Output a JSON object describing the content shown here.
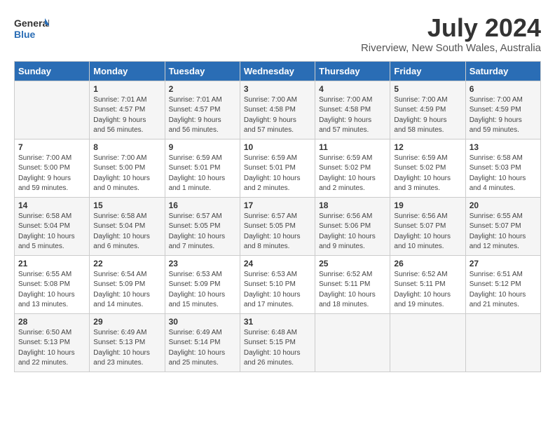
{
  "header": {
    "logo_line1": "General",
    "logo_line2": "Blue",
    "month_year": "July 2024",
    "location": "Riverview, New South Wales, Australia"
  },
  "weekdays": [
    "Sunday",
    "Monday",
    "Tuesday",
    "Wednesday",
    "Thursday",
    "Friday",
    "Saturday"
  ],
  "weeks": [
    [
      {
        "day": "",
        "info": ""
      },
      {
        "day": "1",
        "info": "Sunrise: 7:01 AM\nSunset: 4:57 PM\nDaylight: 9 hours\nand 56 minutes."
      },
      {
        "day": "2",
        "info": "Sunrise: 7:01 AM\nSunset: 4:57 PM\nDaylight: 9 hours\nand 56 minutes."
      },
      {
        "day": "3",
        "info": "Sunrise: 7:00 AM\nSunset: 4:58 PM\nDaylight: 9 hours\nand 57 minutes."
      },
      {
        "day": "4",
        "info": "Sunrise: 7:00 AM\nSunset: 4:58 PM\nDaylight: 9 hours\nand 57 minutes."
      },
      {
        "day": "5",
        "info": "Sunrise: 7:00 AM\nSunset: 4:59 PM\nDaylight: 9 hours\nand 58 minutes."
      },
      {
        "day": "6",
        "info": "Sunrise: 7:00 AM\nSunset: 4:59 PM\nDaylight: 9 hours\nand 59 minutes."
      }
    ],
    [
      {
        "day": "7",
        "info": "Sunrise: 7:00 AM\nSunset: 5:00 PM\nDaylight: 9 hours\nand 59 minutes."
      },
      {
        "day": "8",
        "info": "Sunrise: 7:00 AM\nSunset: 5:00 PM\nDaylight: 10 hours\nand 0 minutes."
      },
      {
        "day": "9",
        "info": "Sunrise: 6:59 AM\nSunset: 5:01 PM\nDaylight: 10 hours\nand 1 minute."
      },
      {
        "day": "10",
        "info": "Sunrise: 6:59 AM\nSunset: 5:01 PM\nDaylight: 10 hours\nand 2 minutes."
      },
      {
        "day": "11",
        "info": "Sunrise: 6:59 AM\nSunset: 5:02 PM\nDaylight: 10 hours\nand 2 minutes."
      },
      {
        "day": "12",
        "info": "Sunrise: 6:59 AM\nSunset: 5:02 PM\nDaylight: 10 hours\nand 3 minutes."
      },
      {
        "day": "13",
        "info": "Sunrise: 6:58 AM\nSunset: 5:03 PM\nDaylight: 10 hours\nand 4 minutes."
      }
    ],
    [
      {
        "day": "14",
        "info": "Sunrise: 6:58 AM\nSunset: 5:04 PM\nDaylight: 10 hours\nand 5 minutes."
      },
      {
        "day": "15",
        "info": "Sunrise: 6:58 AM\nSunset: 5:04 PM\nDaylight: 10 hours\nand 6 minutes."
      },
      {
        "day": "16",
        "info": "Sunrise: 6:57 AM\nSunset: 5:05 PM\nDaylight: 10 hours\nand 7 minutes."
      },
      {
        "day": "17",
        "info": "Sunrise: 6:57 AM\nSunset: 5:05 PM\nDaylight: 10 hours\nand 8 minutes."
      },
      {
        "day": "18",
        "info": "Sunrise: 6:56 AM\nSunset: 5:06 PM\nDaylight: 10 hours\nand 9 minutes."
      },
      {
        "day": "19",
        "info": "Sunrise: 6:56 AM\nSunset: 5:07 PM\nDaylight: 10 hours\nand 10 minutes."
      },
      {
        "day": "20",
        "info": "Sunrise: 6:55 AM\nSunset: 5:07 PM\nDaylight: 10 hours\nand 12 minutes."
      }
    ],
    [
      {
        "day": "21",
        "info": "Sunrise: 6:55 AM\nSunset: 5:08 PM\nDaylight: 10 hours\nand 13 minutes."
      },
      {
        "day": "22",
        "info": "Sunrise: 6:54 AM\nSunset: 5:09 PM\nDaylight: 10 hours\nand 14 minutes."
      },
      {
        "day": "23",
        "info": "Sunrise: 6:53 AM\nSunset: 5:09 PM\nDaylight: 10 hours\nand 15 minutes."
      },
      {
        "day": "24",
        "info": "Sunrise: 6:53 AM\nSunset: 5:10 PM\nDaylight: 10 hours\nand 17 minutes."
      },
      {
        "day": "25",
        "info": "Sunrise: 6:52 AM\nSunset: 5:11 PM\nDaylight: 10 hours\nand 18 minutes."
      },
      {
        "day": "26",
        "info": "Sunrise: 6:52 AM\nSunset: 5:11 PM\nDaylight: 10 hours\nand 19 minutes."
      },
      {
        "day": "27",
        "info": "Sunrise: 6:51 AM\nSunset: 5:12 PM\nDaylight: 10 hours\nand 21 minutes."
      }
    ],
    [
      {
        "day": "28",
        "info": "Sunrise: 6:50 AM\nSunset: 5:13 PM\nDaylight: 10 hours\nand 22 minutes."
      },
      {
        "day": "29",
        "info": "Sunrise: 6:49 AM\nSunset: 5:13 PM\nDaylight: 10 hours\nand 23 minutes."
      },
      {
        "day": "30",
        "info": "Sunrise: 6:49 AM\nSunset: 5:14 PM\nDaylight: 10 hours\nand 25 minutes."
      },
      {
        "day": "31",
        "info": "Sunrise: 6:48 AM\nSunset: 5:15 PM\nDaylight: 10 hours\nand 26 minutes."
      },
      {
        "day": "",
        "info": ""
      },
      {
        "day": "",
        "info": ""
      },
      {
        "day": "",
        "info": ""
      }
    ]
  ]
}
